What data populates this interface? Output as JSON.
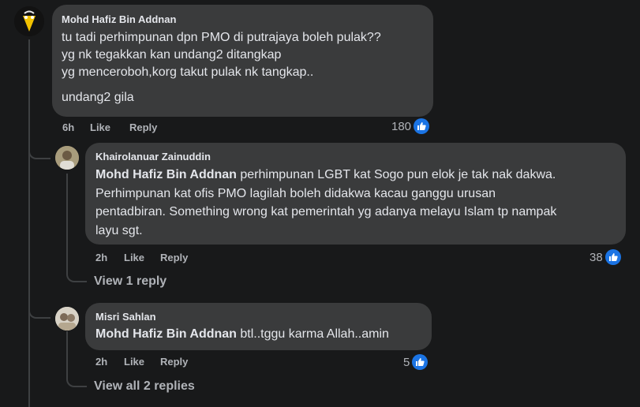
{
  "comment": {
    "author": "Mohd Hafiz Bin Addnan",
    "lines": [
      "tu tadi perhimpunan dpn PMO di putrajaya boleh pulak??",
      "yg nk tegakkan kan undang2 ditangkap",
      "yg menceroboh,korg takut pulak nk tangkap.."
    ],
    "last_line": "undang2 gila",
    "time": "6h",
    "like_label": "Like",
    "reply_label": "Reply",
    "reaction_count": "180"
  },
  "replies": [
    {
      "author": "Khairolanuar Zainuddin",
      "mention": "Mohd Hafiz Bin Addnan",
      "text_line1": " perhimpunan LGBT kat Sogo pun elok je tak nak dakwa.",
      "text_rest": "Perhimpunan kat ofis PMO lagilah boleh didakwa kacau ganggu urusan\npentadbiran. Something wrong kat pemerintah yg adanya melayu Islam tp nampak\nlayu sgt.",
      "time": "2h",
      "like_label": "Like",
      "reply_label": "Reply",
      "reaction_count": "38",
      "view_replies": "View 1 reply"
    },
    {
      "author": "Misri Sahlan",
      "mention": "Mohd Hafiz Bin Addnan",
      "text": " btl..tggu karma Allah..amin",
      "time": "2h",
      "like_label": "Like",
      "reply_label": "Reply",
      "reaction_count": "5",
      "view_replies": "View all 2 replies"
    }
  ]
}
